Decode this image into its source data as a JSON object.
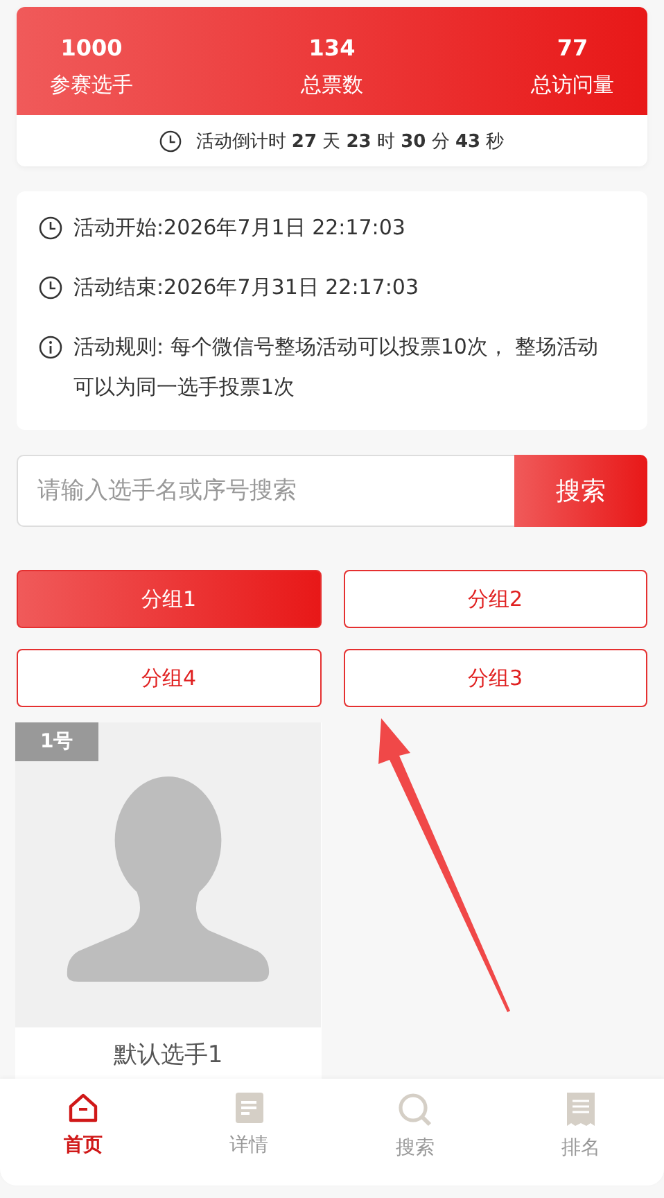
{
  "stats": [
    {
      "value": "1000",
      "label": "参赛选手"
    },
    {
      "value": "134",
      "label": "总票数"
    },
    {
      "value": "77",
      "label": "总访问量"
    }
  ],
  "countdown": "活动倒计时 **27** 天 **23** 时 **30** 分 **43** 秒",
  "info": [
    {
      "kind": "clock",
      "text": "活动开始:2026年7月1日 22:17:03"
    },
    {
      "kind": "clock",
      "text": "活动结束:2026年7月31日 22:17:03"
    },
    {
      "kind": "info",
      "text": "活动规则: 每个微信号整场活动可以投票10次， 整场活动可以为同一选手投票1次"
    }
  ],
  "search": {
    "placeholder": "请输入选手名或序号搜索",
    "button": "搜索"
  },
  "groups": [
    {
      "label": "分组1",
      "selected": true
    },
    {
      "label": "分组2",
      "selected": false
    },
    {
      "label": "分组4",
      "selected": false
    },
    {
      "label": "分组3",
      "selected": false
    }
  ],
  "contestants": [
    {
      "number": "1号",
      "name": "默认选手1"
    }
  ],
  "nav": [
    {
      "kind": "home",
      "label": "首页",
      "selected": true
    },
    {
      "kind": "doc",
      "label": "详情",
      "selected": false
    },
    {
      "kind": "search",
      "label": "搜索",
      "selected": false
    },
    {
      "kind": "receipt",
      "label": "排名",
      "selected": false
    }
  ]
}
